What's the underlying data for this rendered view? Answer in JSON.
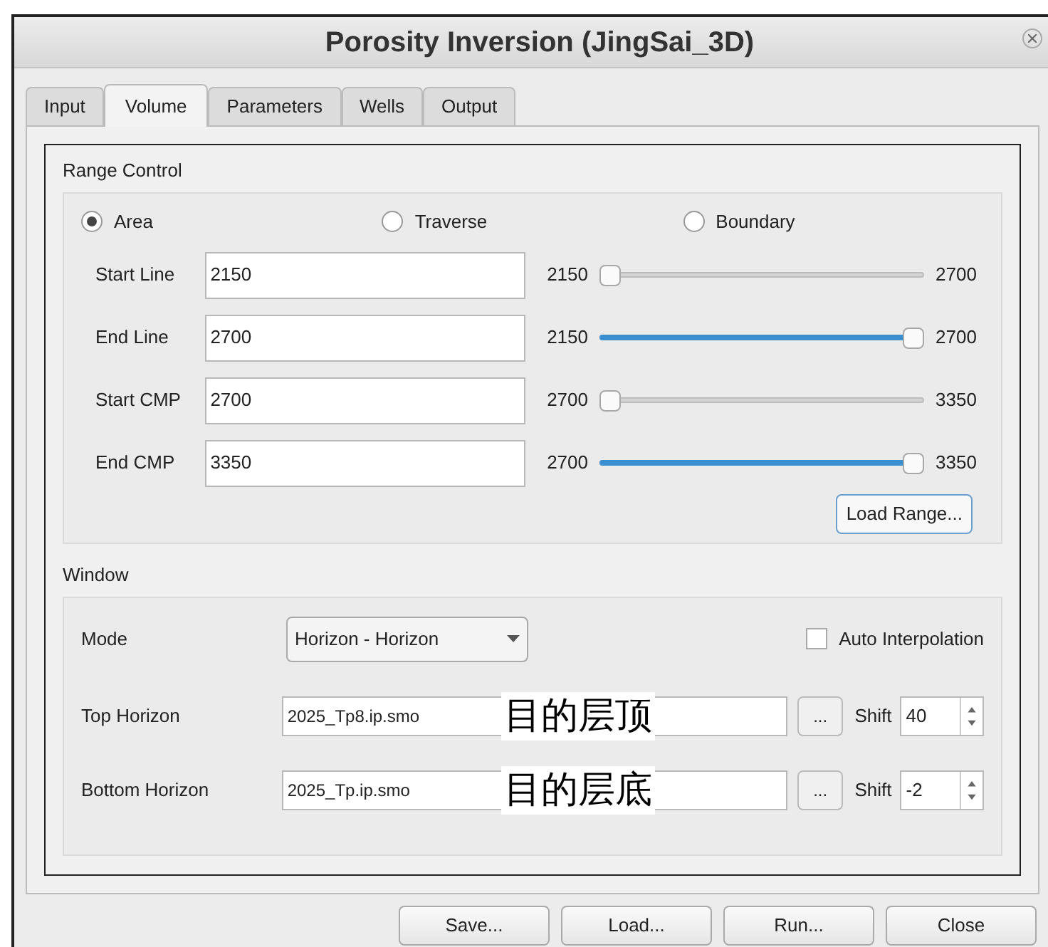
{
  "window": {
    "title": "Porosity Inversion (JingSai_3D)"
  },
  "tabs": [
    {
      "label": "Input",
      "selected": false
    },
    {
      "label": "Volume",
      "selected": true
    },
    {
      "label": "Parameters",
      "selected": false
    },
    {
      "label": "Wells",
      "selected": false
    },
    {
      "label": "Output",
      "selected": false
    }
  ],
  "range_control": {
    "title": "Range Control",
    "modes": [
      {
        "label": "Area",
        "selected": true
      },
      {
        "label": "Traverse",
        "selected": false
      },
      {
        "label": "Boundary",
        "selected": false
      }
    ],
    "rows": [
      {
        "label": "Start Line",
        "value": "2150",
        "min": "2150",
        "max": "2700",
        "level": 0
      },
      {
        "label": "End Line",
        "value": "2700",
        "min": "2150",
        "max": "2700",
        "level": 1
      },
      {
        "label": "Start CMP",
        "value": "2700",
        "min": "2700",
        "max": "3350",
        "level": 0
      },
      {
        "label": "End CMP",
        "value": "3350",
        "min": "2700",
        "max": "3350",
        "level": 1
      }
    ],
    "load_button": "Load Range..."
  },
  "window_group": {
    "title": "Window",
    "mode_label": "Mode",
    "mode_value": "Horizon - Horizon",
    "auto_interpolation": {
      "label": "Auto Interpolation",
      "checked": false
    },
    "horizons": [
      {
        "label": "Top Horizon",
        "value": "2025_Tp8.ip.smo",
        "annotation": "目的层顶",
        "browse": "...",
        "shift_label": "Shift",
        "shift": "40"
      },
      {
        "label": "Bottom Horizon",
        "value": "2025_Tp.ip.smo",
        "annotation": "目的层底",
        "browse": "...",
        "shift_label": "Shift",
        "shift": "-2"
      }
    ]
  },
  "buttons": [
    "Save...",
    "Load...",
    "Run...",
    "Close"
  ]
}
